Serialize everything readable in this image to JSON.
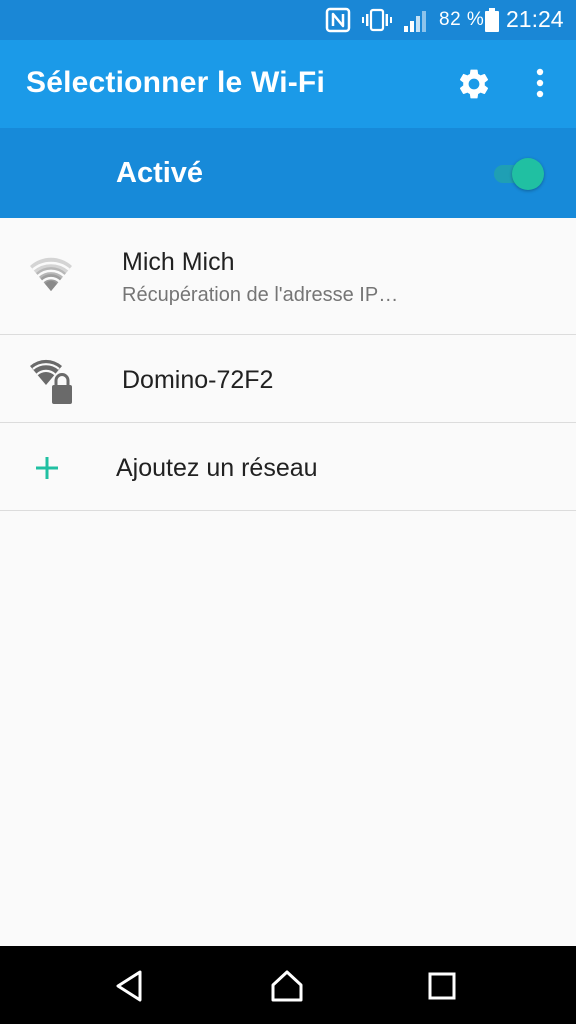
{
  "status_bar": {
    "battery_percent": "82 %",
    "time": "21:24",
    "icons": [
      "nfc-icon",
      "vibrate-icon",
      "signal-icon",
      "battery-icon"
    ]
  },
  "app_bar": {
    "title": "Sélectionner le Wi-Fi",
    "icons": [
      "settings-gear-icon",
      "more-vertical-icon"
    ]
  },
  "wifi_toggle": {
    "label": "Activé",
    "state": "on"
  },
  "networks": [
    {
      "name": "Mich Mich",
      "status": "Récupération de l'adresse IP…",
      "icon": "wifi-signal-icon"
    },
    {
      "name": "Domino-72F2",
      "icon": "wifi-locked-icon"
    }
  ],
  "add_network": {
    "label": "Ajoutez un réseau",
    "icon": "plus-icon"
  },
  "nav_bar": {
    "icons": [
      "back-icon",
      "home-icon",
      "recent-apps-icon"
    ]
  },
  "colors": {
    "status_bar": "#1a87d6",
    "app_bar": "#1b9ae8",
    "toggle_bar": "#178ad9",
    "accent": "#20c0a2",
    "background": "#fafafa"
  }
}
